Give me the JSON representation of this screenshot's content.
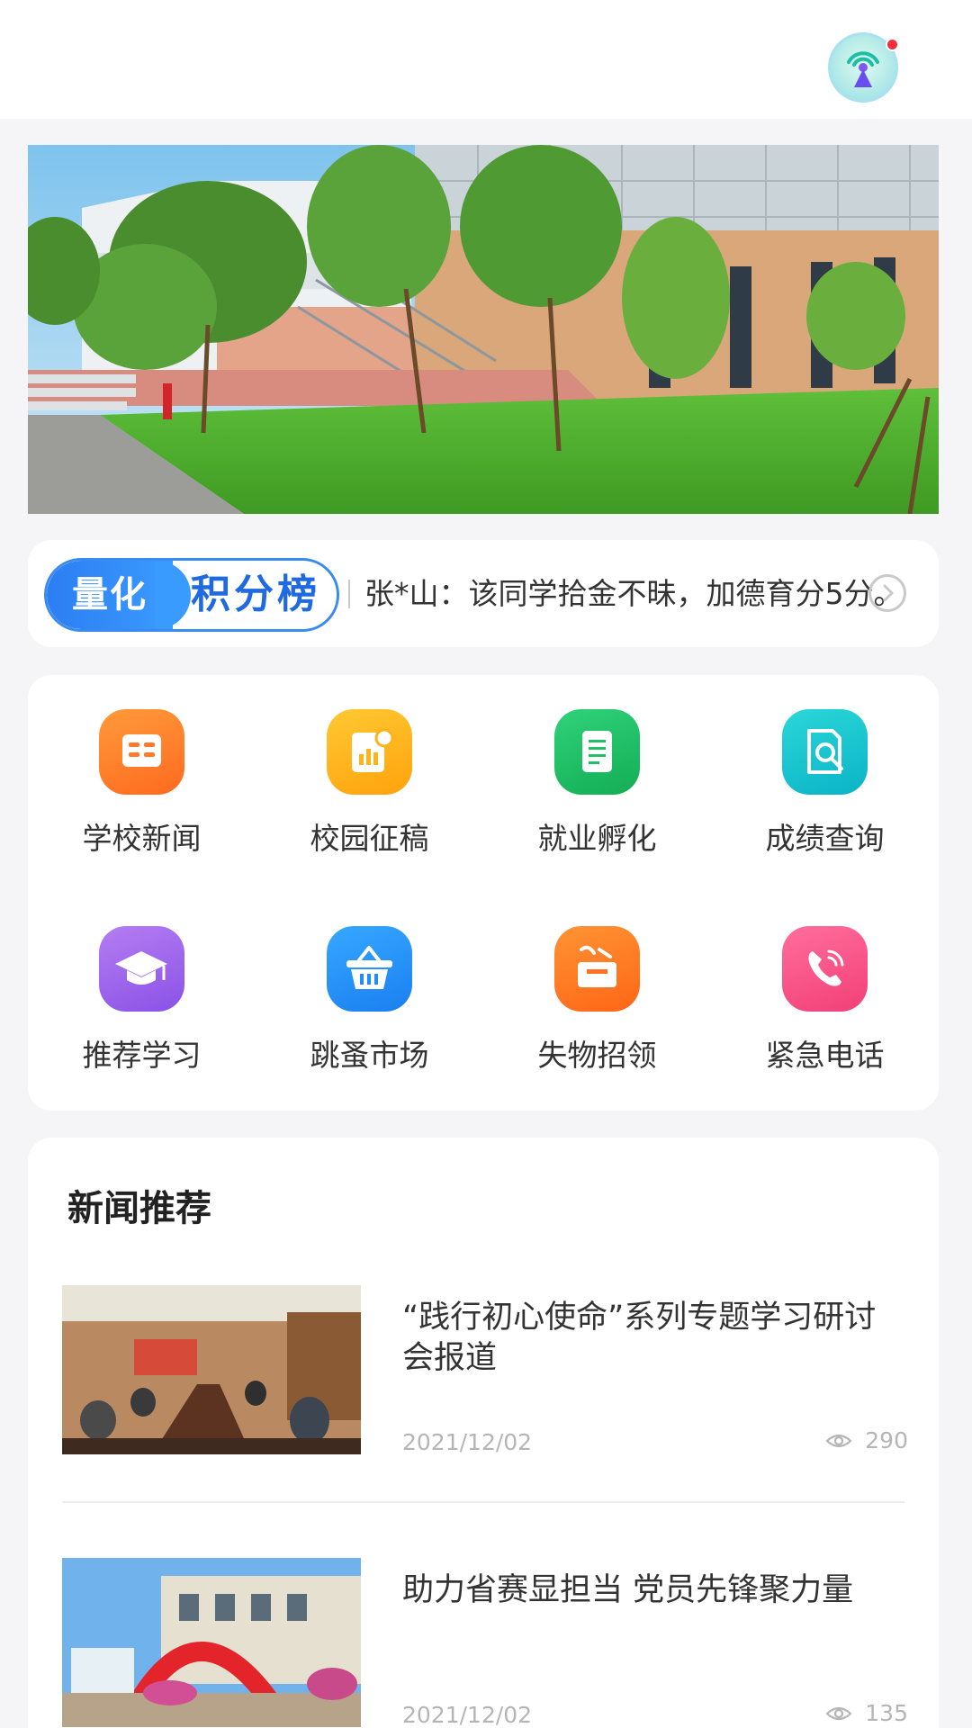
{
  "header": {
    "broadcast_icon": "broadcast-icon",
    "notification_dot_color": "#f42e3f"
  },
  "banner": {
    "image": "campus-building-photo",
    "page_indicator": {
      "count": 2,
      "active": 2
    }
  },
  "ticker": {
    "badge_left": "量化",
    "badge_right": "积分榜",
    "message": "张*山：该同学拾金不昧，加德育分5分。",
    "arrow_icon": "chevron-right-circle-icon"
  },
  "menu": {
    "items": [
      {
        "label": "学校新闻",
        "icon": "news-icon",
        "color": "#ff7a2a"
      },
      {
        "label": "校园征稿",
        "icon": "submission-icon",
        "color": "#ffb317"
      },
      {
        "label": "就业孵化",
        "icon": "document-icon",
        "color": "#22c064"
      },
      {
        "label": "成绩查询",
        "icon": "search-document-icon",
        "color": "#16c1cf"
      },
      {
        "label": "推荐学习",
        "icon": "graduation-cap-icon",
        "color": "#9b63ea"
      },
      {
        "label": "跳蚤市场",
        "icon": "basket-icon",
        "color": "#1f8ff5"
      },
      {
        "label": "失物招领",
        "icon": "lost-found-box-icon",
        "color": "#ff7222"
      },
      {
        "label": "紧急电话",
        "icon": "phone-icon",
        "color": "#f74c86"
      }
    ]
  },
  "news": {
    "section_title": "新闻推荐",
    "articles": [
      {
        "title": "“践行初心使命”系列专题学习研讨会报道",
        "date": "2021/12/02",
        "views": "290"
      },
      {
        "title": "助力省赛显担当 党员先锋聚力量",
        "date": "2021/12/02",
        "views": "135"
      }
    ]
  }
}
